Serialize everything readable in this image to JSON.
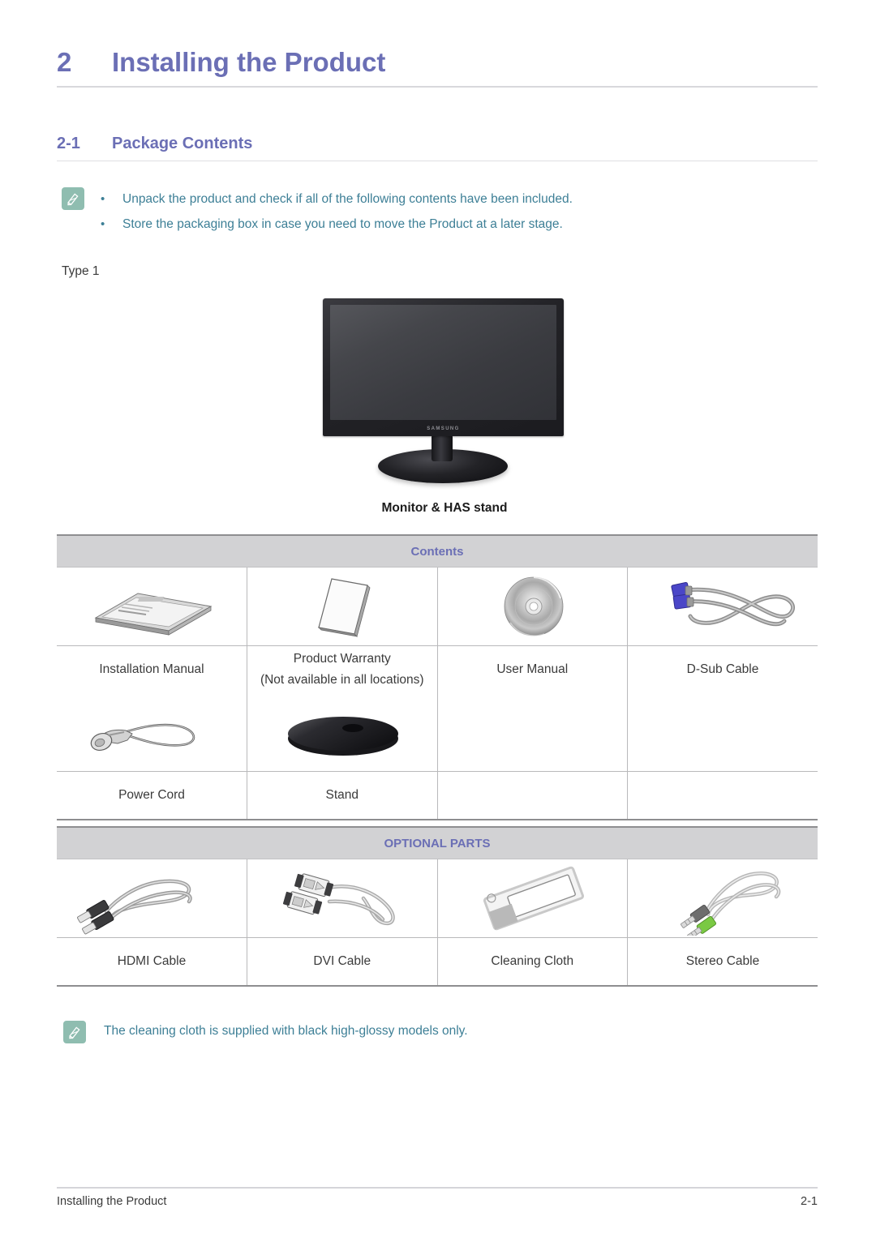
{
  "chapter": {
    "number": "2",
    "title": "Installing the Product"
  },
  "section": {
    "number": "2-1",
    "title": "Package Contents"
  },
  "top_note": {
    "icon": "note-pencil-icon",
    "bullet": "•",
    "items": [
      "Unpack the product and check if all of the following contents have been included.",
      "Store the packaging box in case you need to move the Product at a later stage."
    ]
  },
  "type_label": "Type  1",
  "hero": {
    "logo": "SAMSUNG",
    "caption": "Monitor & HAS stand"
  },
  "contents_table": {
    "band_label": "Contents",
    "rows": [
      {
        "cells": [
          {
            "icon": "installation-manual-icon",
            "label": "Installation Manual",
            "sublabel": ""
          },
          {
            "icon": "product-warranty-icon",
            "label": "Product Warranty",
            "sublabel": "(Not available in all locations)"
          },
          {
            "icon": "cd-disc-icon",
            "label": "User Manual",
            "sublabel": ""
          },
          {
            "icon": "dsub-cable-icon",
            "label": "D-Sub Cable",
            "sublabel": ""
          }
        ]
      },
      {
        "cells": [
          {
            "icon": "power-cord-icon",
            "label": "Power Cord",
            "sublabel": ""
          },
          {
            "icon": "stand-icon",
            "label": "Stand",
            "sublabel": ""
          },
          {
            "icon": "",
            "label": "",
            "sublabel": ""
          },
          {
            "icon": "",
            "label": "",
            "sublabel": ""
          }
        ]
      }
    ]
  },
  "optional_table": {
    "band_label": "OPTIONAL PARTS",
    "rows": [
      {
        "cells": [
          {
            "icon": "hdmi-cable-icon",
            "label": "HDMI Cable",
            "sublabel": ""
          },
          {
            "icon": "dvi-cable-icon",
            "label": "DVI Cable",
            "sublabel": ""
          },
          {
            "icon": "cleaning-cloth-icon",
            "label": "Cleaning Cloth",
            "sublabel": ""
          },
          {
            "icon": "stereo-cable-icon",
            "label": "Stereo Cable",
            "sublabel": ""
          }
        ]
      }
    ]
  },
  "bottom_note": {
    "icon": "note-pencil-icon",
    "text": "The cleaning cloth is supplied with black high-glossy models only."
  },
  "footer": {
    "left": "Installing the Product",
    "right": "2-1"
  },
  "colors": {
    "heading": "#6b6fb5",
    "note_text": "#3d7f96",
    "note_icon_bg": "#8fbdb0",
    "band_bg": "#d2d2d4",
    "body_text": "#3b3b3b"
  }
}
